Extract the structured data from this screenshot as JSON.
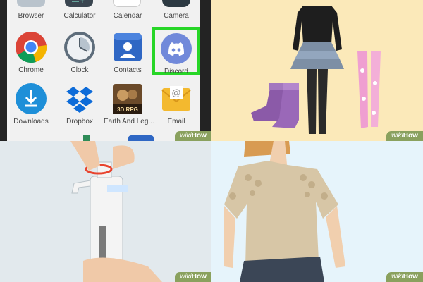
{
  "panels": {
    "top_left": {
      "top_row_apps": [
        {
          "label": "Browser"
        },
        {
          "label": "Calculator"
        },
        {
          "label": "Calendar"
        },
        {
          "label": "Camera"
        }
      ],
      "apps": [
        {
          "label": "Chrome",
          "icon": "chrome-icon"
        },
        {
          "label": "Clock",
          "icon": "clock-icon"
        },
        {
          "label": "Contacts",
          "icon": "contacts-icon"
        },
        {
          "label": "Discord",
          "icon": "discord-icon",
          "highlighted": true
        },
        {
          "label": "Downloads",
          "icon": "downloads-icon"
        },
        {
          "label": "Dropbox",
          "icon": "dropbox-icon"
        },
        {
          "label": "Earth And Leg...",
          "icon": "earth-and-legend-icon",
          "icon_text": "3D RPG"
        },
        {
          "label": "Email",
          "icon": "email-icon"
        }
      ],
      "highlight_color": "#27d627"
    },
    "top_right": {
      "description_icon": "outfit-illustration"
    },
    "bottom_left": {
      "description_icon": "pipette-illustration"
    },
    "bottom_right": {
      "description_icon": "lace-blouse-illustration"
    }
  },
  "watermark": {
    "prefix": "wiki",
    "suffix": "How"
  }
}
